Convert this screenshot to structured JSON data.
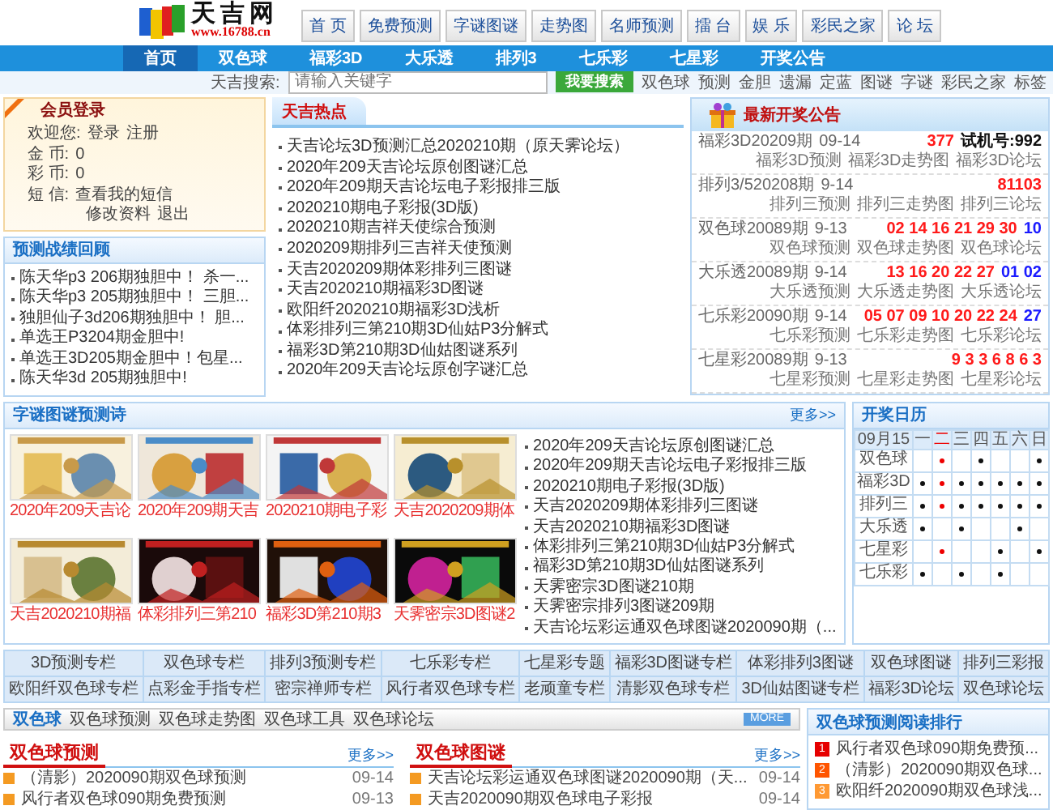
{
  "logo": {
    "title": "天吉网",
    "url": "www.16788.cn"
  },
  "top_nav": [
    "首 页",
    "免费预测",
    "字谜图谜",
    "走势图",
    "名师预测",
    "擂 台",
    "娱 乐",
    "彩民之家",
    "论 坛"
  ],
  "main_nav": [
    {
      "label": "首页",
      "selected": true
    },
    {
      "label": "双色球",
      "selected": false
    },
    {
      "label": "福彩3D",
      "selected": false
    },
    {
      "label": "大乐透",
      "selected": false
    },
    {
      "label": "排列3",
      "selected": false
    },
    {
      "label": "七乐彩",
      "selected": false
    },
    {
      "label": "七星彩",
      "selected": false
    },
    {
      "label": "开奖公告",
      "selected": false
    }
  ],
  "search": {
    "label": "天吉搜索:",
    "placeholder": "请输入关键字",
    "button": "我要搜索",
    "tags": [
      "双色球",
      "预测",
      "金胆",
      "遗漏",
      "定蓝",
      "图谜",
      "字谜",
      "彩民之家",
      "标签"
    ]
  },
  "login": {
    "title": "会员登录",
    "welcome": "欢迎您:",
    "links": [
      "登录",
      "注册"
    ],
    "fields": [
      {
        "label": "金 币:",
        "value": "0"
      },
      {
        "label": "彩 币:",
        "value": "0"
      },
      {
        "label": "短 信:",
        "value": "查看我的短信"
      }
    ],
    "actions": [
      "修改资料",
      "退出"
    ]
  },
  "review": {
    "title": "预测战绩回顾",
    "items": [
      "陈天华p3 206期独胆中！ 杀一...",
      "陈天华p3 205期独胆中！ 三胆...",
      "独胆仙子3d206期独胆中！ 胆...",
      "单选王P3204期金胆中!",
      "单选王3D205期金胆中！包星...",
      "陈天华3d 205期独胆中!"
    ]
  },
  "hot": {
    "title": "天吉热点",
    "items": [
      "天吉论坛3D预测汇总2020210期（原天霁论坛）",
      "2020年209天吉论坛原创图谜汇总",
      "2020年209期天吉论坛电子彩报排三版",
      "2020210期电子彩报(3D版)",
      "2020210期吉祥天使综合预测",
      "2020209期排列三吉祥天使预测",
      "天吉2020209期体彩排列三图谜",
      "天吉2020210期福彩3D图谜",
      "欧阳纤2020210期福彩3D浅析",
      "体彩排列三第210期3D仙姑P3分解式",
      "福彩3D第210期3D仙姑图谜系列",
      "2020年209天吉论坛原创字谜汇总"
    ]
  },
  "results": {
    "title": "最新开奖公告",
    "entries": [
      {
        "name": "福彩3D20209期",
        "date": "09-14",
        "balls": [
          {
            "text": "377",
            "color": "#ff1a1a"
          }
        ],
        "trial": "试机号:992",
        "links": [
          "福彩3D预测",
          "福彩3D走势图",
          "福彩3D论坛"
        ]
      },
      {
        "name": "排列3/520208期",
        "date": "9-14",
        "balls": [
          {
            "text": "81103",
            "color": "#ff1a1a"
          }
        ],
        "links": [
          "排列三预测",
          "排列三走势图",
          "排列三论坛"
        ]
      },
      {
        "name": "双色球20089期",
        "date": "9-13",
        "balls": [
          {
            "text": "02 14 16 21 29 30",
            "color": "#ff1a1a"
          },
          {
            "text": "10",
            "color": "#1a1aff"
          }
        ],
        "links": [
          "双色球预测",
          "双色球走势图",
          "双色球论坛"
        ]
      },
      {
        "name": "大乐透20089期",
        "date": "9-14",
        "balls": [
          {
            "text": "13 16 20 22 27",
            "color": "#ff1a1a"
          },
          {
            "text": "01 02",
            "color": "#1a1aff"
          }
        ],
        "links": [
          "大乐透预测",
          "大乐透走势图",
          "大乐透论坛"
        ]
      },
      {
        "name": "七乐彩20090期",
        "date": "9-14",
        "balls": [
          {
            "text": "05 07 09 10 20 22 24",
            "color": "#ff1a1a"
          },
          {
            "text": "27",
            "color": "#1a1aff"
          }
        ],
        "links": [
          "七乐彩预测",
          "七乐彩走势图",
          "七乐彩论坛"
        ]
      },
      {
        "name": "七星彩20089期",
        "date": "9-13",
        "balls": [
          {
            "text": "9 3 3 6 8 6 3",
            "color": "#ff1a1a"
          }
        ],
        "links": [
          "七星彩预测",
          "七星彩走势图",
          "七星彩论坛"
        ]
      }
    ]
  },
  "riddles": {
    "title": "字谜图谜预测诗",
    "more": "更多>>",
    "pictures": [
      {
        "kind": "picture",
        "caption": "2020年209天吉论"
      },
      {
        "kind": "picture",
        "caption": "2020年209期天吉"
      },
      {
        "kind": "picture",
        "caption": "2020210期电子彩"
      },
      {
        "kind": "picture",
        "caption": "天吉2020209期体"
      },
      {
        "kind": "picture",
        "caption": "天吉2020210期福"
      },
      {
        "kind": "picture",
        "caption": "体彩排列三第210"
      },
      {
        "kind": "picture",
        "caption": "福彩3D第210期3"
      },
      {
        "kind": "picture",
        "caption": "天霁密宗3D图谜2"
      }
    ],
    "items": [
      "2020年209天吉论坛原创图谜汇总",
      "2020年209期天吉论坛电子彩报排三版",
      "2020210期电子彩报(3D版)",
      "天吉2020209期体彩排列三图谜",
      "天吉2020210期福彩3D图谜",
      "体彩排列三第210期3D仙姑P3分解式",
      "福彩3D第210期3D仙姑图谜系列",
      "天霁密宗3D图谜210期",
      "天霁密宗排列3图谜209期",
      "天吉论坛彩运通双色球图谜2020090期（..."
    ]
  },
  "calendar": {
    "title": "开奖日历",
    "date": "09月15",
    "days": [
      {
        "label": "一",
        "selected": false
      },
      {
        "label": "二",
        "selected": true
      },
      {
        "label": "三",
        "selected": false
      },
      {
        "label": "四",
        "selected": false
      },
      {
        "label": "五",
        "selected": false
      },
      {
        "label": "六",
        "selected": false
      },
      {
        "label": "日",
        "selected": false
      }
    ],
    "rows": [
      {
        "name": "双色球",
        "draws": [
          false,
          true,
          false,
          true,
          false,
          false,
          true
        ]
      },
      {
        "name": "福彩3D",
        "draws": [
          true,
          true,
          true,
          true,
          true,
          true,
          true
        ]
      },
      {
        "name": "排列三",
        "draws": [
          true,
          true,
          true,
          true,
          true,
          true,
          true
        ]
      },
      {
        "name": "大乐透",
        "draws": [
          true,
          false,
          true,
          false,
          false,
          true,
          false
        ]
      },
      {
        "name": "七星彩",
        "draws": [
          false,
          true,
          false,
          false,
          true,
          false,
          true
        ]
      },
      {
        "name": "七乐彩",
        "draws": [
          true,
          false,
          true,
          false,
          true,
          false,
          false
        ]
      }
    ]
  },
  "columns": [
    [
      "3D预测专栏",
      "双色球专栏",
      "排列3预测专栏",
      "七乐彩专栏",
      "七星彩专题",
      "福彩3D图谜专栏",
      "体彩排列3图谜",
      "双色球图谜",
      "排列三彩报"
    ],
    [
      "欧阳纤双色球专栏",
      "点彩金手指专栏",
      "密宗禅师专栏",
      "风行者双色球专栏",
      "老顽童专栏",
      "清影双色球专栏",
      "3D仙姑图谜专栏",
      "福彩3D论坛",
      "双色球论坛"
    ]
  ],
  "ssq_bar": {
    "title": "双色球",
    "links": [
      "双色球预测",
      "双色球走势图",
      "双色球工具",
      "双色球论坛"
    ],
    "more": "MORE"
  },
  "lists": [
    {
      "title": "双色球预测",
      "more": "更多>>",
      "items": [
        {
          "text": "（清影）2020090期双色球预测",
          "date": "09-14"
        },
        {
          "text": "风行者双色球090期免费预测",
          "date": "09-13"
        }
      ]
    },
    {
      "title": "双色球图谜",
      "more": "更多>>",
      "items": [
        {
          "text": "天吉论坛彩运通双色球图谜2020090期（天...",
          "date": "09-14"
        },
        {
          "text": "天吉2020090期双色球电子彩报",
          "date": "09-14"
        }
      ]
    }
  ],
  "ranking": {
    "title": "双色球预测阅读排行",
    "items": [
      {
        "rank": "1",
        "color": "#e60000",
        "text": "风行者双色球090期免费预..."
      },
      {
        "rank": "2",
        "color": "#ff5500",
        "text": "（清影）2020090期双色球..."
      },
      {
        "rank": "3",
        "color": "#ff9933",
        "text": "欧阳纤2020090期双色球浅..."
      }
    ]
  }
}
